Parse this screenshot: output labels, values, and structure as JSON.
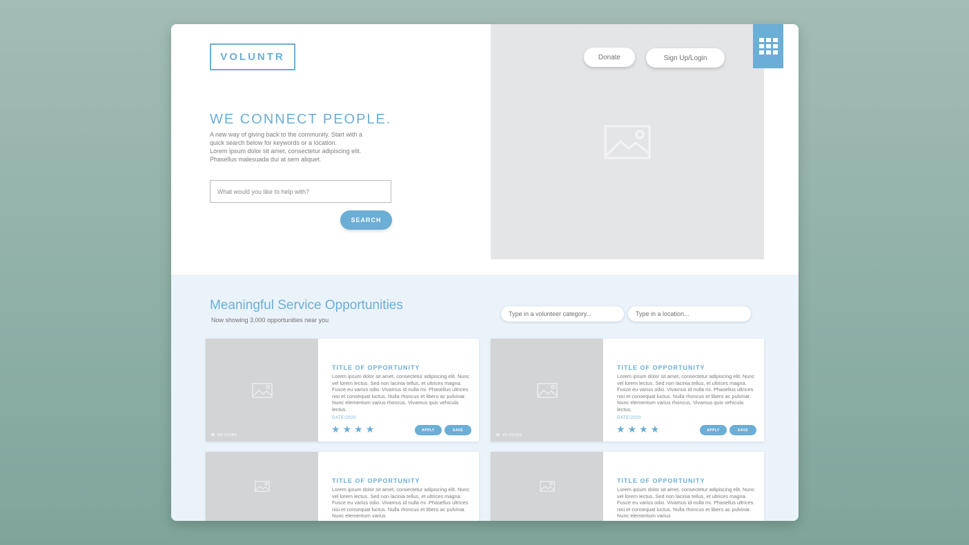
{
  "brand": {
    "logo": "VOLUNTR",
    "accent": "#6baed6"
  },
  "header": {
    "donate_label": "Donate",
    "signup_label": "Sign Up/Login",
    "menu_icon": "grid-icon"
  },
  "hero": {
    "title": "WE CONNECT PEOPLE.",
    "description": [
      "A new way of giving back to the community. Start with a",
      "quick search below for keywords or a location.",
      "Lorem ipsum dolor sit amet, consectetur adipiscing elit.",
      "Phasellus malesuada dui at sem aliquet."
    ],
    "search_placeholder": "What would you like to help with?",
    "search_button": "SEARCH",
    "image_icon": "image-placeholder-icon"
  },
  "opportunities": {
    "title": "Meaningful Service Opportunities",
    "subtitle": "Now showing 3,000 opportunities near you",
    "category_placeholder": "Type in a volunteer category...",
    "location_placeholder": "Type in a location...",
    "cards": [
      {
        "title": "TITLE OF OPPORTUNITY",
        "text": "Lorem ipsum dolor sit amet, consectetur adipiscing elit. Nunc vel lorem lectus. Sed non lacinia tellus, et ultrices magna. Fusce eu varius odio. Vivamus id nulla mi. Phasellus ultrices nisi et consequat luctus. Nulla rhoncus et libero ac pulvinar. Nunc elementum varius rhoncus. Vivamus quis vehicula lectus.",
        "date": "DATE/2020",
        "views": "XX VIEWS",
        "rating": 4,
        "apply_label": "APPLY",
        "save_label": "SAVE"
      },
      {
        "title": "TITLE OF OPPORTUNITY",
        "text": "Lorem ipsum dolor sit amet, consectetur adipiscing elit. Nunc vel lorem lectus. Sed non lacinia tellus, et ultrices magna. Fusce eu varius odio. Vivamus id nulla mi. Phasellus ultrices nisi et consequat luctus. Nulla rhoncus et libero ac pulvinar. Nunc elementum varius rhoncus. Vivamus quis vehicula lectus.",
        "date": "DATE/2020",
        "views": "XX VIEWS",
        "rating": 4,
        "apply_label": "APPLY",
        "save_label": "SAVE"
      },
      {
        "title": "TITLE OF OPPORTUNITY",
        "text": "Lorem ipsum dolor sit amet, consectetur adipiscing elit. Nunc vel lorem lectus. Sed non lacinia tellus, et ultrices magna. Fusce eu varius odio. Vivamus id nulla mi. Phasellus ultrices nisi et consequat luctus. Nulla rhoncus et libero ac pulvinar. Nunc elementum varius"
      },
      {
        "title": "TITLE OF OPPORTUNITY",
        "text": "Lorem ipsum dolor sit amet, consectetur adipiscing elit. Nunc vel lorem lectus. Sed non lacinia tellus, et ultrices magna. Fusce eu varius odio. Vivamus id nulla mi. Phasellus ultrices nisi et consequat luctus. Nulla rhoncus et libero ac pulvinar. Nunc elementum varius"
      }
    ]
  }
}
